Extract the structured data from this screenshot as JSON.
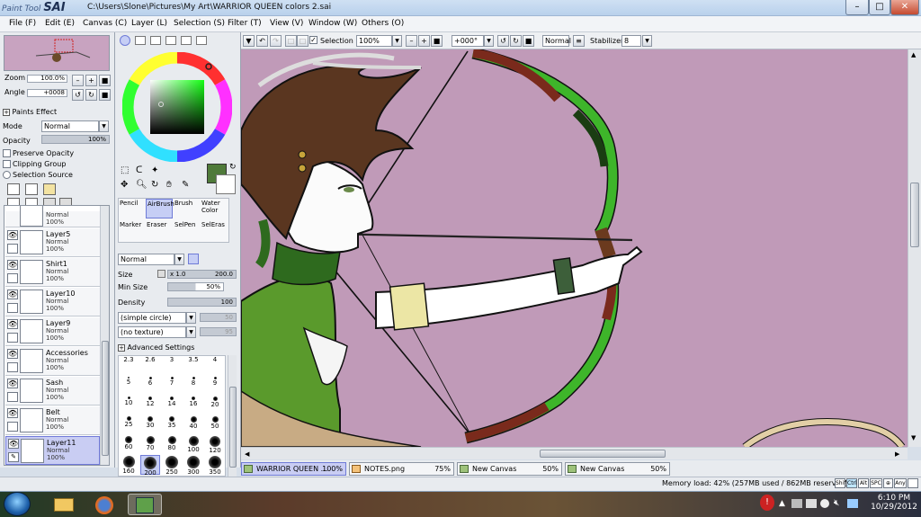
{
  "window": {
    "app_name_prefix": "Paint Tool",
    "app_name": "SAI",
    "title": "C:\\Users\\Slone\\Pictures\\My Art\\WARRIOR QUEEN colors 2.sai",
    "minimize": "–",
    "maximize": "□",
    "close": "✕"
  },
  "menu": [
    {
      "label": "File (F)"
    },
    {
      "label": "Edit (E)"
    },
    {
      "label": "Canvas (C)"
    },
    {
      "label": "Layer (L)"
    },
    {
      "label": "Selection (S)"
    },
    {
      "label": "Filter (T)"
    },
    {
      "label": "View (V)"
    },
    {
      "label": "Window (W)"
    },
    {
      "label": "Others (O)"
    }
  ],
  "toolbar": {
    "selection_label": "Selection",
    "selection_checked": true,
    "zoom_value": "100%",
    "angle_value": "+000°",
    "blend_mode": "Normal",
    "stabilizer_label": "Stabilizer",
    "stabilizer_value": "8"
  },
  "navigator": {
    "zoom_label": "Zoom",
    "zoom_value": "100.0%",
    "angle_label": "Angle",
    "angle_value": "+0008"
  },
  "paints_effect": {
    "header": "Paints Effect",
    "mode_label": "Mode",
    "mode_value": "Normal",
    "opacity_label": "Opacity",
    "opacity_value": "100%",
    "preserve_opacity": "Preserve Opacity",
    "clipping_group": "Clipping Group",
    "selection_source": "Selection Source"
  },
  "layers": [
    {
      "name": "Layer5",
      "mode": "Normal",
      "opacity": "100%"
    },
    {
      "name": "Shirt1",
      "mode": "Normal",
      "opacity": "100%"
    },
    {
      "name": "Layer10",
      "mode": "Normal",
      "opacity": "100%"
    },
    {
      "name": "Layer9",
      "mode": "Normal",
      "opacity": "100%"
    },
    {
      "name": "Accessories",
      "mode": "Normal",
      "opacity": "100%"
    },
    {
      "name": "Sash",
      "mode": "Normal",
      "opacity": "100%"
    },
    {
      "name": "Belt",
      "mode": "Normal",
      "opacity": "100%"
    },
    {
      "name": "Layer11",
      "mode": "Normal",
      "opacity": "100%"
    }
  ],
  "layer_partial": {
    "mode": "Normal",
    "opacity": "100%"
  },
  "colors": {
    "primary": "#4f7a3a",
    "canvas_bg": "#c09ab8",
    "selected_blue": "#c9cdf3"
  },
  "tools": [
    {
      "label": "Pencil"
    },
    {
      "label": "AirBrush"
    },
    {
      "label": "Brush"
    },
    {
      "label": "Water Color"
    },
    {
      "label": "Marker"
    },
    {
      "label": "Eraser"
    },
    {
      "label": "SelPen"
    },
    {
      "label": "SelEras"
    }
  ],
  "brush": {
    "mode_value": "Normal",
    "size_label": "Size",
    "size_mult": "x 1.0",
    "size_value": "200.0",
    "min_size_label": "Min Size",
    "min_size_value": "50%",
    "density_label": "Density",
    "density_value": "100",
    "shape_value": "(simple circle)",
    "shape_amount": "50",
    "texture_value": "(no texture)",
    "texture_amount": "95",
    "advanced_settings": "Advanced Settings",
    "size_presets": [
      "2.3",
      "2.6",
      "3",
      "3.5",
      "4",
      "5",
      "6",
      "7",
      "8",
      "9",
      "10",
      "12",
      "14",
      "16",
      "20",
      "25",
      "30",
      "35",
      "40",
      "50",
      "60",
      "70",
      "80",
      "100",
      "120",
      "160",
      "200",
      "250",
      "300",
      "350"
    ]
  },
  "tabs": [
    {
      "name": "WARRIOR QUEEN ...",
      "pct": "100%"
    },
    {
      "name": "NOTES.png",
      "pct": "75%"
    },
    {
      "name": "New Canvas",
      "pct": "50%"
    },
    {
      "name": "New Canvas",
      "pct": "50%"
    }
  ],
  "status": {
    "memory": "Memory load: 42% (257MB used / 862MB reserved)",
    "keys": [
      "Shift",
      "Ctrl",
      "Alt",
      "SPC",
      "⊕",
      "Any"
    ]
  },
  "taskbar": {
    "time": "6:10 PM",
    "date": "10/29/2012"
  }
}
